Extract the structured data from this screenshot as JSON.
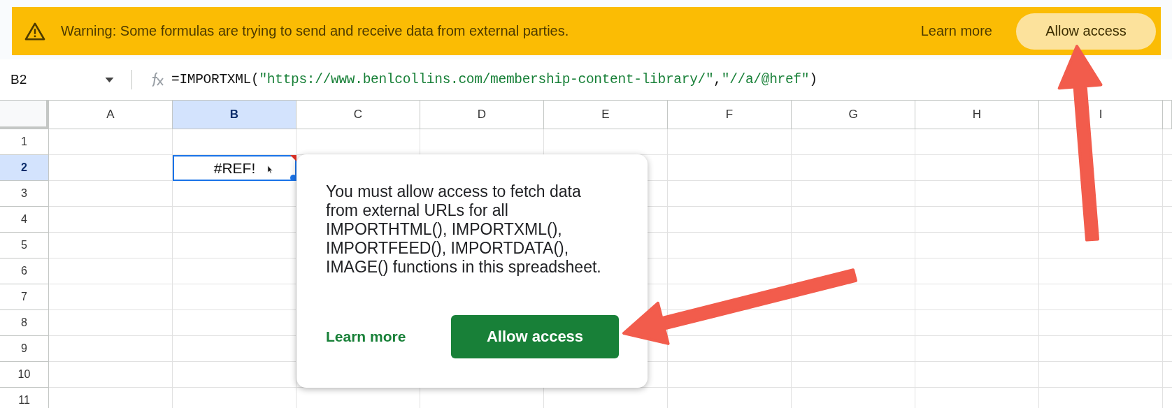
{
  "banner": {
    "message": "Warning: Some formulas are trying to send and receive data from external parties.",
    "learn_more": "Learn more",
    "button": "Allow access"
  },
  "formula_bar": {
    "cell_ref": "B2",
    "formula": [
      {
        "kind": "plain",
        "text": "=IMPORTXML("
      },
      {
        "kind": "string",
        "text": "\"https://www.benlcollins.com/membership-content-library/\""
      },
      {
        "kind": "plain",
        "text": ","
      },
      {
        "kind": "string",
        "text": "\"//a/@href\""
      },
      {
        "kind": "plain",
        "text": ")"
      }
    ]
  },
  "sheet": {
    "columns": [
      {
        "label": "A",
        "selected": false
      },
      {
        "label": "B",
        "selected": true
      },
      {
        "label": "C",
        "selected": false
      },
      {
        "label": "D",
        "selected": false
      },
      {
        "label": "E",
        "selected": false
      },
      {
        "label": "F",
        "selected": false
      },
      {
        "label": "G",
        "selected": false
      },
      {
        "label": "H",
        "selected": false
      },
      {
        "label": "I",
        "selected": false
      }
    ],
    "rows": [
      {
        "label": "1",
        "selected": false
      },
      {
        "label": "2",
        "selected": true
      },
      {
        "label": "3",
        "selected": false
      },
      {
        "label": "4",
        "selected": false
      },
      {
        "label": "5",
        "selected": false
      },
      {
        "label": "6",
        "selected": false
      },
      {
        "label": "7",
        "selected": false
      },
      {
        "label": "8",
        "selected": false
      },
      {
        "label": "9",
        "selected": false
      },
      {
        "label": "10",
        "selected": false
      },
      {
        "label": "11",
        "selected": false
      }
    ],
    "active_cell": {
      "value": "#REF!",
      "error": true
    }
  },
  "popup": {
    "message": "You must allow access to fetch data from external URLs for all IMPORTHTML(), IMPORTXML(), IMPORTFEED(), IMPORTDATA(), IMAGE() functions in this spreadsheet.",
    "learn_more": "Learn more",
    "button": "Allow access"
  }
}
